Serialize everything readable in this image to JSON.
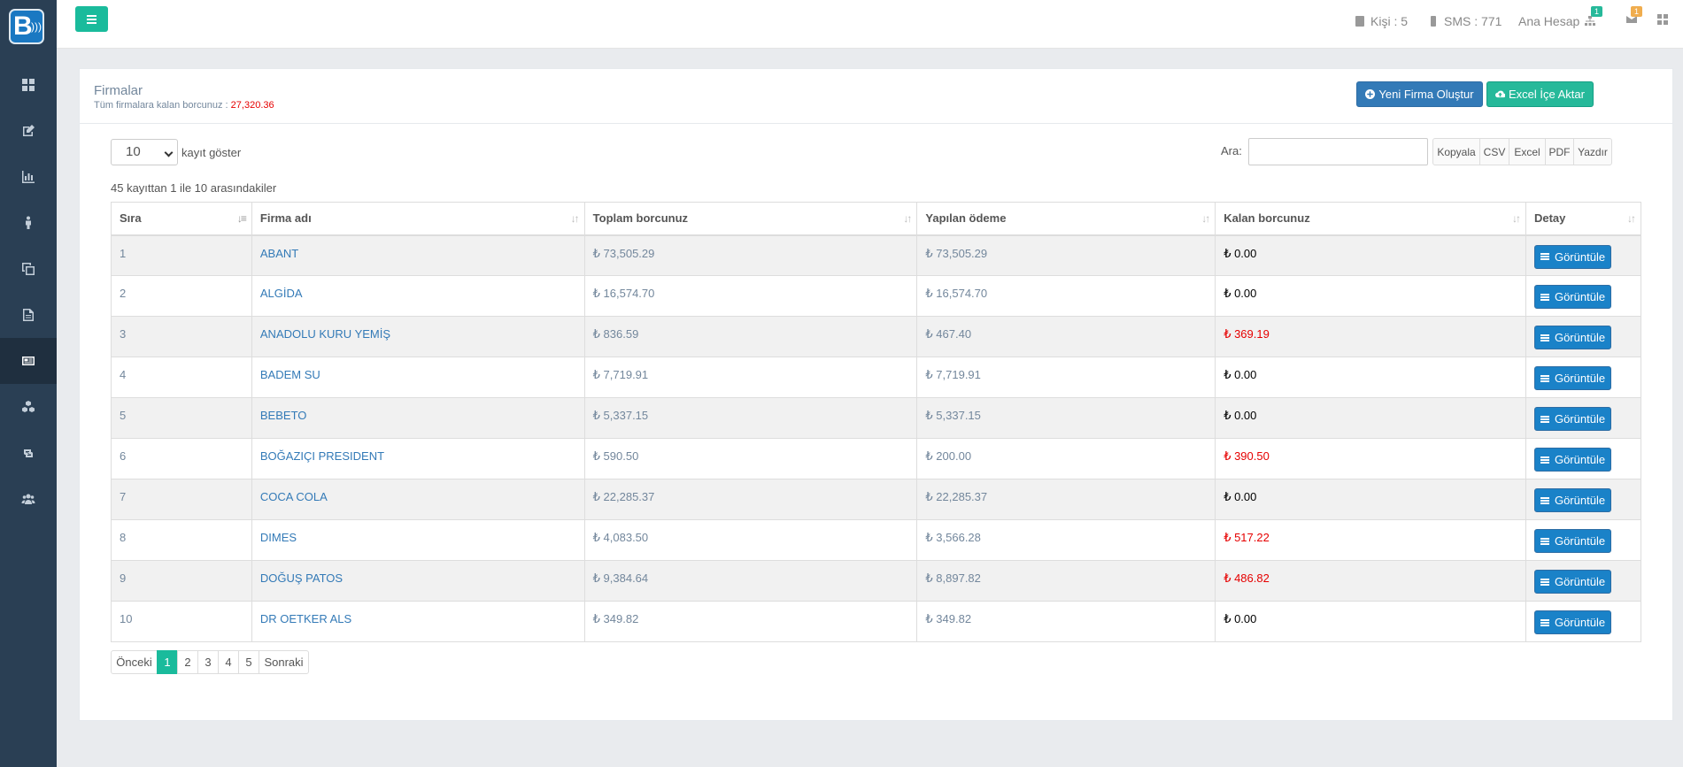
{
  "app": {
    "logo_letter": "B"
  },
  "sidebar": {
    "items": [
      {
        "icon": "dashboard-icon"
      },
      {
        "icon": "edit-icon"
      },
      {
        "icon": "bar-chart-icon"
      },
      {
        "icon": "person-icon"
      },
      {
        "icon": "copy-icon"
      },
      {
        "icon": "file-icon"
      },
      {
        "icon": "newspaper-icon",
        "active": true
      },
      {
        "icon": "cubes-icon"
      },
      {
        "icon": "retweet-icon"
      },
      {
        "icon": "users-icon"
      }
    ]
  },
  "topbar": {
    "kisi": "Kişi : 5",
    "sms": "SMS : 771",
    "account": "Ana Hesap",
    "account_badge": "1",
    "mail_badge": "1"
  },
  "panel": {
    "title": "Firmalar",
    "subtitle_prefix": "Tüm firmalara kalan borcunuz : ",
    "subtitle_value": "27,320.36",
    "new_button": "Yeni Firma Oluştur",
    "import_button": "Excel İçe Aktar"
  },
  "controls": {
    "length_value": "10",
    "length_label": "kayıt göster",
    "info": "45 kayıttan 1 ile 10 arasındakiler",
    "search_label": "Ara:",
    "search_value": "",
    "export_buttons": [
      "Kopyala",
      "CSV",
      "Excel",
      "PDF",
      "Yazdır"
    ]
  },
  "table": {
    "headers": [
      "Sıra",
      "Firma adı",
      "Toplam borcunuz",
      "Yapılan ödeme",
      "Kalan borcunuz",
      "Detay"
    ],
    "view_label": "Görüntüle",
    "rows": [
      {
        "sira": "1",
        "firma": "ABANT",
        "toplam": "₺ 73,505.29",
        "odeme": "₺ 73,505.29",
        "kalan": "₺ 0.00",
        "kalan_red": false
      },
      {
        "sira": "2",
        "firma": "ALGİDA",
        "toplam": "₺ 16,574.70",
        "odeme": "₺ 16,574.70",
        "kalan": "₺ 0.00",
        "kalan_red": false
      },
      {
        "sira": "3",
        "firma": "ANADOLU KURU YEMİŞ",
        "toplam": "₺ 836.59",
        "odeme": "₺ 467.40",
        "kalan": "₺ 369.19",
        "kalan_red": true
      },
      {
        "sira": "4",
        "firma": "BADEM SU",
        "toplam": "₺ 7,719.91",
        "odeme": "₺ 7,719.91",
        "kalan": "₺ 0.00",
        "kalan_red": false
      },
      {
        "sira": "5",
        "firma": "BEBETO",
        "toplam": "₺ 5,337.15",
        "odeme": "₺ 5,337.15",
        "kalan": "₺ 0.00",
        "kalan_red": false
      },
      {
        "sira": "6",
        "firma": "BOĞAZIÇI PRESIDENT",
        "toplam": "₺ 590.50",
        "odeme": "₺ 200.00",
        "kalan": "₺ 390.50",
        "kalan_red": true
      },
      {
        "sira": "7",
        "firma": "COCA COLA",
        "toplam": "₺ 22,285.37",
        "odeme": "₺ 22,285.37",
        "kalan": "₺ 0.00",
        "kalan_red": false
      },
      {
        "sira": "8",
        "firma": "DIMES",
        "toplam": "₺ 4,083.50",
        "odeme": "₺ 3,566.28",
        "kalan": "₺ 517.22",
        "kalan_red": true
      },
      {
        "sira": "9",
        "firma": "DOĞUŞ PATOS",
        "toplam": "₺ 9,384.64",
        "odeme": "₺ 8,897.82",
        "kalan": "₺ 486.82",
        "kalan_red": true
      },
      {
        "sira": "10",
        "firma": "DR OETKER ALS",
        "toplam": "₺ 349.82",
        "odeme": "₺ 349.82",
        "kalan": "₺ 0.00",
        "kalan_red": false
      }
    ]
  },
  "pagination": {
    "prev": "Önceki",
    "pages": [
      "1",
      "2",
      "3",
      "4",
      "5"
    ],
    "active": "1",
    "next": "Sonraki"
  },
  "colors": {
    "sidebar": "#2a3f54",
    "accent_green": "#1abb9c",
    "primary_blue": "#337ab7",
    "debt_red": "#e60000"
  }
}
